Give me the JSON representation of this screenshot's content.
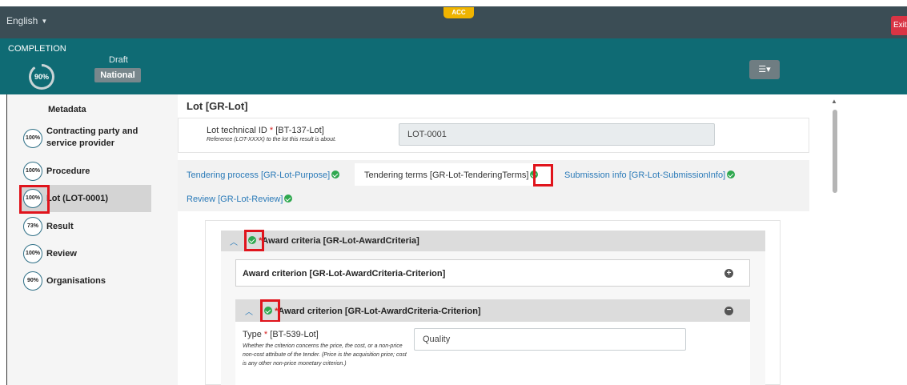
{
  "topbar": {
    "language": "English",
    "env_badge": "ACC",
    "exit_label": "Exit"
  },
  "header": {
    "completion_label": "COMPLETION",
    "completion_pct": "90%",
    "completion_value": 0.9,
    "status": "Draft",
    "scope": "National",
    "filter_icon": "sliders-icon"
  },
  "sidebar": {
    "title": "Metadata",
    "items": [
      {
        "pct": "100%",
        "label": "Contracting party and service provider"
      },
      {
        "pct": "100%",
        "label": "Procedure"
      },
      {
        "pct": "100%",
        "label": "Lot (LOT-0001)"
      },
      {
        "pct": "73%",
        "label": "Result"
      },
      {
        "pct": "100%",
        "label": "Review"
      },
      {
        "pct": "90%",
        "label": "Organisations"
      }
    ]
  },
  "main": {
    "title": "Lot [GR-Lot]",
    "lot_id": {
      "label": "Lot technical ID",
      "code": "[BT-137-Lot]",
      "help": "Reference (LOT-XXXX) to the lot this result is about.",
      "value": "LOT-0001"
    },
    "tabs": [
      {
        "label": "Tendering process  [GR-Lot-Purpose]"
      },
      {
        "label": "Tendering terms  [GR-Lot-TenderingTerms]"
      },
      {
        "label": "Submission info  [GR-Lot-SubmissionInfo]"
      },
      {
        "label": "Review  [GR-Lot-Review]"
      }
    ],
    "group_title": "Award criteria  [GR-Lot-AwardCriteria]",
    "criterion_collapsed": "Award criterion  [GR-Lot-AwardCriteria-Criterion]",
    "criterion_expanded": "Award criterion  [GR-Lot-AwardCriteria-Criterion]",
    "type_field": {
      "label": "Type",
      "code": "[BT-539-Lot]",
      "help": "Whether the criterion concerns the price, the cost, or a non-price non-cost attribute of the tender. (Price is the acquisition price; cost is any other non-price monetary criterion.)",
      "value": "Quality"
    }
  },
  "required_marker": "*",
  "colors": {
    "topbar": "#3b4d55",
    "header": "#0f6b74",
    "highlight": "#e0141c",
    "check": "#2fa84f",
    "link": "#2a7ab8"
  }
}
